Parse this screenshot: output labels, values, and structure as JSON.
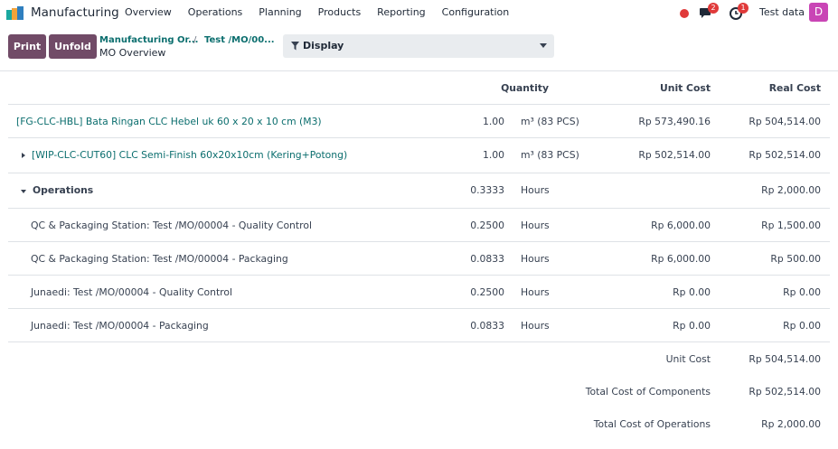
{
  "navbar": {
    "app_name": "Manufacturing",
    "menu": [
      "Overview",
      "Operations",
      "Planning",
      "Products",
      "Reporting",
      "Configuration"
    ],
    "messages_count": "2",
    "activities_count": "1",
    "company": "Test data",
    "avatar_letter": "D"
  },
  "control": {
    "print_label": "Print",
    "unfold_label": "Unfold",
    "breadcrumb_parent": "Manufacturing Or...",
    "breadcrumb_separator": "/",
    "breadcrumb_record": "Test /MO/00...",
    "breadcrumb_current": "MO Overview",
    "display_label": "Display"
  },
  "table": {
    "headers": {
      "quantity": "Quantity",
      "unit_cost": "Unit Cost",
      "real_cost": "Real Cost"
    },
    "rows": [
      {
        "name": "[FG-CLC-HBL] Bata Ringan CLC Hebel uk 60 x 20 x 10 cm (M3)",
        "qty": "1.00",
        "uom": "m³ (83 PCS)",
        "unit_cost": "Rp 573,490.16",
        "real_cost": "Rp 504,514.00"
      },
      {
        "name": "[WIP-CLC-CUT60] CLC Semi-Finish 60x20x10cm (Kering+Potong)",
        "qty": "1.00",
        "uom": "m³ (83 PCS)",
        "unit_cost": "Rp 502,514.00",
        "real_cost": "Rp 502,514.00"
      },
      {
        "name": "Operations",
        "qty": "0.3333",
        "uom": "Hours",
        "unit_cost": "",
        "real_cost": "Rp 2,000.00"
      },
      {
        "name": "QC & Packaging Station: Test /MO/00004 - Quality Control",
        "qty": "0.2500",
        "uom": "Hours",
        "unit_cost": "Rp 6,000.00",
        "real_cost": "Rp 1,500.00"
      },
      {
        "name": "QC & Packaging Station: Test /MO/00004 - Packaging",
        "qty": "0.0833",
        "uom": "Hours",
        "unit_cost": "Rp 6,000.00",
        "real_cost": "Rp 500.00"
      },
      {
        "name": "Junaedi: Test /MO/00004 - Quality Control",
        "qty": "0.2500",
        "uom": "Hours",
        "unit_cost": "Rp 0.00",
        "real_cost": "Rp 0.00"
      },
      {
        "name": "Junaedi: Test /MO/00004 - Packaging",
        "qty": "0.0833",
        "uom": "Hours",
        "unit_cost": "Rp 0.00",
        "real_cost": "Rp 0.00"
      }
    ],
    "totals": [
      {
        "label": "Unit Cost",
        "value": "Rp 504,514.00"
      },
      {
        "label": "Total Cost of Components",
        "value": "Rp 502,514.00"
      },
      {
        "label": "Total Cost of Operations",
        "value": "Rp 2,000.00"
      }
    ]
  },
  "colors": {
    "brand": "#714b67",
    "link": "#0b6e6e",
    "badge": "#e03a3a",
    "avatar": "#c945b5"
  }
}
